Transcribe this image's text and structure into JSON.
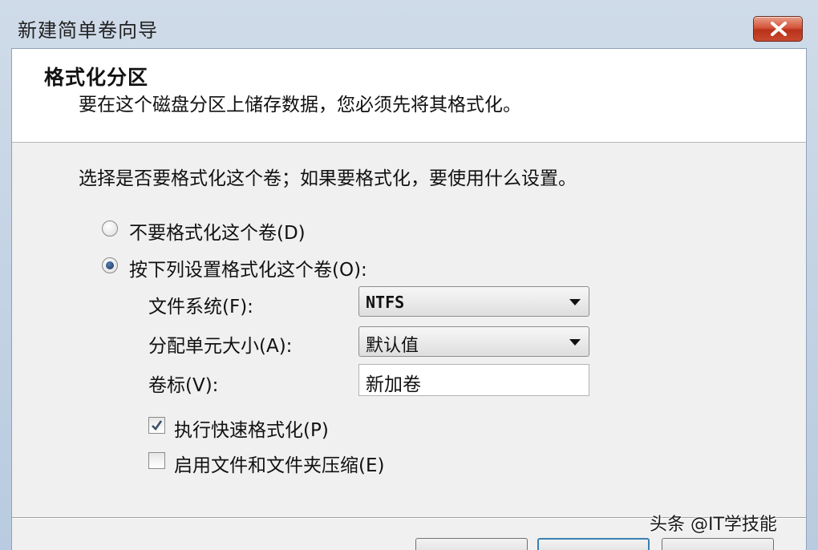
{
  "window": {
    "title": "新建简单卷向导",
    "close_icon": "close-icon"
  },
  "header": {
    "title": "格式化分区",
    "subtitle": "要在这个磁盘分区上储存数据，您必须先将其格式化。"
  },
  "prompt": "选择是否要格式化这个卷；如果要格式化，要使用什么设置。",
  "options": {
    "no_format": {
      "label": "不要格式化这个卷(D)",
      "selected": false
    },
    "format": {
      "label": "按下列设置格式化这个卷(O):",
      "selected": true
    }
  },
  "settings": {
    "file_system": {
      "label": "文件系统(F):",
      "value": "NTFS"
    },
    "allocation_unit": {
      "label": "分配单元大小(A):",
      "value": "默认值"
    },
    "volume_label": {
      "label": "卷标(V):",
      "value": "新加卷"
    }
  },
  "checkboxes": {
    "quick_format": {
      "label": "执行快速格式化(P)",
      "checked": true
    },
    "compression": {
      "label": "启用文件和文件夹压缩(E)",
      "checked": false
    }
  },
  "watermark": "头条 @IT学技能",
  "colors": {
    "accent": "#14315f",
    "close_button": "#c9492e"
  }
}
